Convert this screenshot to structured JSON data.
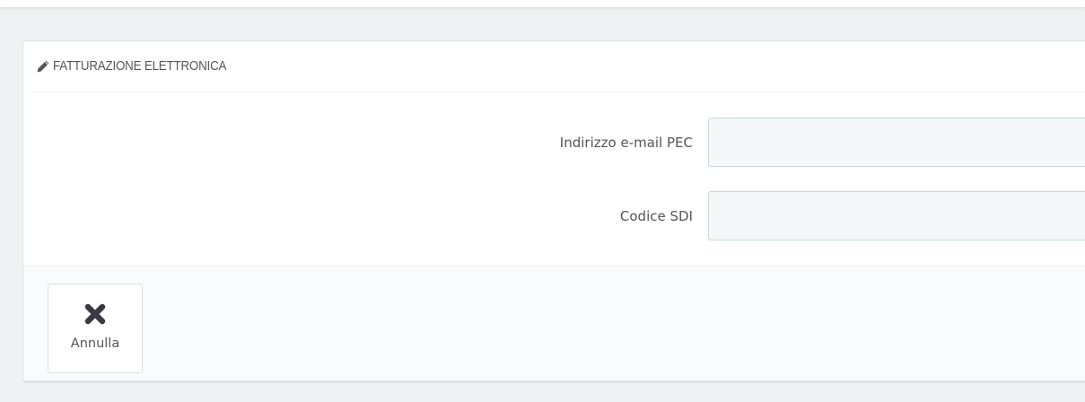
{
  "panel": {
    "title": "FATTURAZIONE ELETTRONICA",
    "title_icon": "pencil-icon"
  },
  "form": {
    "pec_label": "Indirizzo e-mail PEC",
    "pec_value": "",
    "sdi_label": "Codice SDI",
    "sdi_value": ""
  },
  "footer": {
    "cancel_label": "Annulla",
    "cancel_icon": "close-icon"
  }
}
